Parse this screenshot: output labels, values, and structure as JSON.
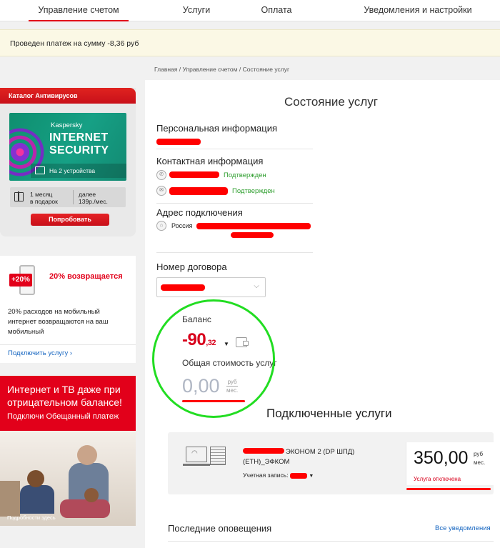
{
  "nav": {
    "tabs": [
      {
        "label": "Управление счетом",
        "active": true
      },
      {
        "label": "Услуги",
        "active": false
      },
      {
        "label": "Оплата",
        "active": false
      },
      {
        "label": "Уведомления и настройки",
        "active": false
      }
    ]
  },
  "notice": {
    "text": "Проведен платеж на сумму -8,36  руб"
  },
  "breadcrumb": [
    "Главная",
    "Управление счетом",
    "Состояние услуг"
  ],
  "antivirus": {
    "header": "Каталог Антивирусов",
    "brand": "Kaspersky",
    "product": "INTERNET SECURITY",
    "devices": "На 2 устройства",
    "promo_a": "1 месяц\nв подарок",
    "promo_b": "далее\n139р./мес.",
    "button": "Попробовать"
  },
  "cashback": {
    "badge": "+20%",
    "title": "20% возвращается",
    "text": "20% расходов на мобильный интернет возвращаются на ваш мобильный",
    "link": "Подключить услугу ›"
  },
  "promo": {
    "title": "Интернет и ТВ даже при отрицательном балансе!",
    "subtitle": "Подключи Обещанный платеж",
    "caption": "Подробности здесь"
  },
  "main": {
    "title": "Состояние услуг",
    "personal_label": "Персональная информация",
    "contact_label": "Контактная информация",
    "phone_status": "Подтвержден",
    "email_status": "Подтвержден",
    "address_label": "Адрес подключения",
    "address_prefix": "Россия",
    "contract_label": "Номер договора",
    "balance_label": "Баланс",
    "balance_int": "-90",
    "balance_dec": ",32",
    "cost_label": "Общая стоимость услуг",
    "cost_value": "0,00",
    "cost_unit_top": "руб",
    "cost_unit_bottom": "мес."
  },
  "services": {
    "title": "Подключенные услуги",
    "items": [
      {
        "name": "ЭКОНОМ 2 (DP ШПД) (ETH)_ЭФКОМ",
        "account_label": "Учетная запись:",
        "price": "350,00",
        "unit_top": "руб",
        "unit_bottom": "мес.",
        "status": "Услуга отключена"
      }
    ]
  },
  "notifications": {
    "title": "Последние оповещения",
    "all_link": "Все уведомления"
  },
  "colors": {
    "accent": "#e2001a",
    "confirmed": "#2e9e2e",
    "link": "#1565c0",
    "highlight_circle": "#22dd22"
  }
}
